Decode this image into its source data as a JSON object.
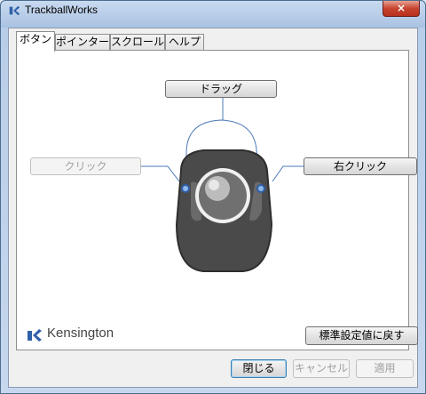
{
  "window": {
    "title": "TrackballWorks",
    "close_label": "×"
  },
  "tabs": [
    {
      "label": "ボタン",
      "active": true
    },
    {
      "label": "ポインター",
      "active": false
    },
    {
      "label": "スクロール",
      "active": false
    },
    {
      "label": "ヘルプ",
      "active": false
    }
  ],
  "buttons_tab": {
    "drag_label": "ドラッグ",
    "click_label": "クリック",
    "right_click_label": "右クリック",
    "restore_defaults_label": "標準設定値に戻す"
  },
  "brand": {
    "name": "Kensington"
  },
  "footer": {
    "close_label": "閉じる",
    "cancel_label": "キャンセル",
    "apply_label": "適用"
  },
  "colors": {
    "accent_blue": "#4a78b8",
    "device_dark": "#4a4a4a"
  }
}
